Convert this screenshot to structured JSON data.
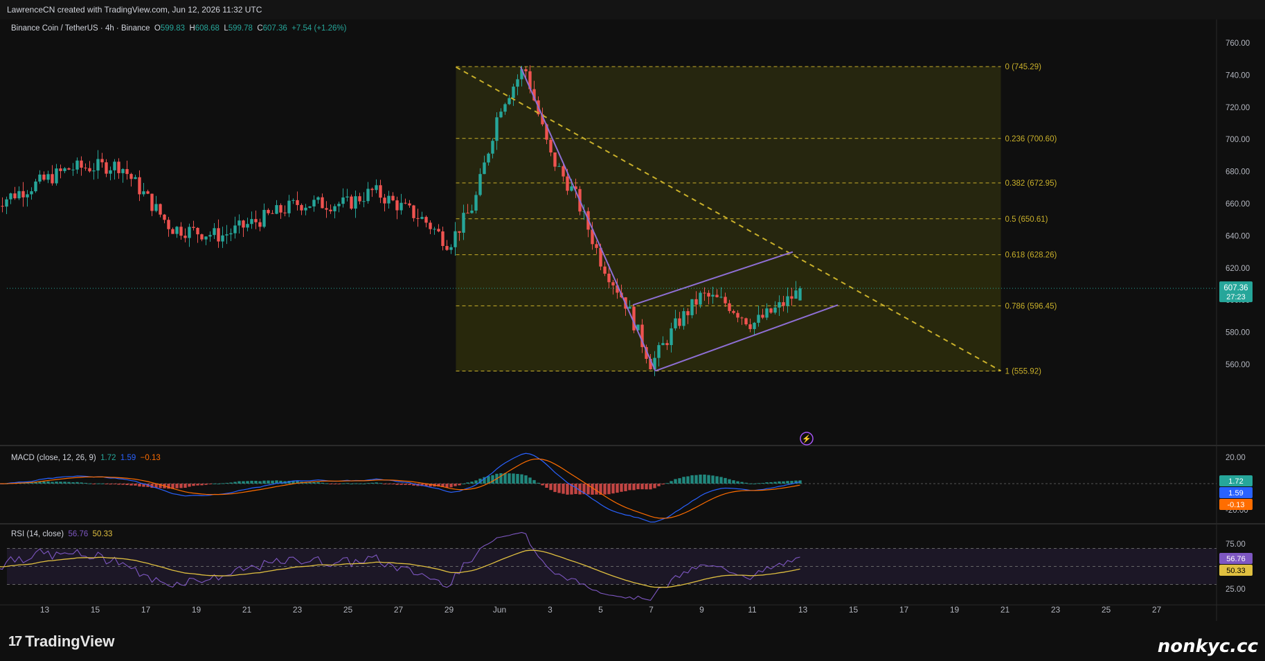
{
  "header": {
    "attribution": "LawrenceCN created with TradingView.com, Jun 12, 2026 11:32 UTC"
  },
  "symbol": {
    "title": "Binance Coin / TetherUS · 4h · Binance",
    "o_label": "O",
    "o": "599.83",
    "h_label": "H",
    "h": "608.68",
    "l_label": "L",
    "l": "599.78",
    "c_label": "C",
    "c": "607.36",
    "change": "+7.54 (+1.26%)"
  },
  "macd_legend": {
    "label": "MACD (close, 12, 26, 9)",
    "v1": "1.72",
    "v2": "1.59",
    "v3": "−0.13"
  },
  "rsi_legend": {
    "label": "RSI (14, close)",
    "v1": "56.76",
    "v2": "50.33"
  },
  "footer": {
    "brand": "TradingView",
    "watermark": "nonkyc.cc"
  },
  "colors": {
    "up": "#26a69a",
    "down": "#ef5350",
    "fib": "#c9b02a",
    "channel": "#8e6fd4",
    "macd": "#2962ff",
    "signal": "#ff6d00",
    "rsi": "#7e57c2",
    "rsi_ma": "#e0c040"
  },
  "chart_data": [
    {
      "type": "candlestick",
      "title": "Binance Coin / TetherUS · 4h · Binance",
      "x_ticks": [
        "13",
        "15",
        "17",
        "19",
        "21",
        "23",
        "25",
        "27",
        "29",
        "Jun",
        "3",
        "5",
        "7",
        "9",
        "11",
        "13",
        "15",
        "17",
        "19",
        "21",
        "23",
        "25",
        "27"
      ],
      "y_ticks": [
        "760.00",
        "740.00",
        "720.00",
        "700.00",
        "680.00",
        "660.00",
        "640.00",
        "620.00",
        "600.00",
        "580.00",
        "560.00"
      ],
      "ylim": [
        553,
        770
      ],
      "last_price": "607.36",
      "countdown": "27:23",
      "fibonacci": [
        {
          "label": "0 (745.29)",
          "value": 745.29
        },
        {
          "label": "0.236 (700.60)",
          "value": 700.6
        },
        {
          "label": "0.382 (672.95)",
          "value": 672.95
        },
        {
          "label": "0.5 (650.61)",
          "value": 650.61
        },
        {
          "label": "0.618 (628.26)",
          "value": 628.26
        },
        {
          "label": "0.786 (596.45)",
          "value": 596.45
        },
        {
          "label": "1 (555.92)",
          "value": 555.92
        }
      ],
      "key_points": [
        {
          "date": "May 11",
          "close": 660
        },
        {
          "date": "May 14",
          "close": 682
        },
        {
          "date": "May 16",
          "close": 684
        },
        {
          "date": "May 18",
          "close": 645
        },
        {
          "date": "May 20",
          "close": 640
        },
        {
          "date": "May 23",
          "close": 660
        },
        {
          "date": "May 25",
          "close": 660
        },
        {
          "date": "May 26",
          "close": 668
        },
        {
          "date": "May 28",
          "close": 650
        },
        {
          "date": "May 29",
          "close": 635
        },
        {
          "date": "May 30",
          "close": 660
        },
        {
          "date": "May 31",
          "close": 720
        },
        {
          "date": "Jun 1",
          "close": 745
        },
        {
          "date": "Jun 2",
          "close": 690
        },
        {
          "date": "Jun 3",
          "close": 665
        },
        {
          "date": "Jun 4",
          "close": 625
        },
        {
          "date": "Jun 5",
          "close": 598
        },
        {
          "date": "Jun 6",
          "close": 560
        },
        {
          "date": "Jun 7",
          "close": 585
        },
        {
          "date": "Jun 8",
          "close": 603
        },
        {
          "date": "Jun 9",
          "close": 598
        },
        {
          "date": "Jun 10",
          "close": 585
        },
        {
          "date": "Jun 11",
          "close": 595
        },
        {
          "date": "Jun 12",
          "close": 607.36
        }
      ]
    },
    {
      "type": "bar",
      "title": "MACD (close, 12, 26, 9)",
      "y_ticks": [
        "20.00",
        "-20.00"
      ],
      "ylim": [
        -25,
        25
      ],
      "values_labels": [
        "1.72",
        "1.59",
        "-0.13"
      ]
    },
    {
      "type": "line",
      "title": "RSI (14, close)",
      "y_ticks": [
        "75.00",
        "25.00"
      ],
      "ylim": [
        20,
        85
      ],
      "values_labels": [
        "56.76",
        "50.33"
      ]
    }
  ]
}
